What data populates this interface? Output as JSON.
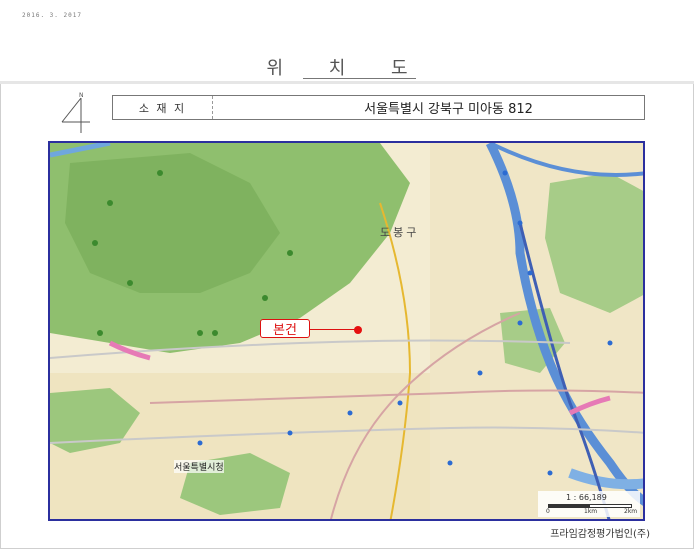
{
  "header": {
    "stamp": "2016. 3. 2017",
    "title": "위 치 도"
  },
  "compass": {
    "north_label": "N"
  },
  "address": {
    "label": "소 재 지",
    "value": "서울특별시 강북구 미아동 812"
  },
  "map": {
    "subject_label": "본건",
    "district_label": "도봉구",
    "city_hall_label": "서울특별시청",
    "scale": {
      "ratio": "1 : 66,189",
      "ticks": [
        "0",
        "1km",
        "2km"
      ]
    },
    "colors": {
      "background": "#f3ecd2",
      "mountain": "#8fbf6e",
      "river": "#5b8fd6",
      "highway": "#3f5fb4",
      "border": "#2b2f9e",
      "marker": "#e51010"
    }
  },
  "footer": {
    "firm": "프라임감정평가법인(주)"
  }
}
